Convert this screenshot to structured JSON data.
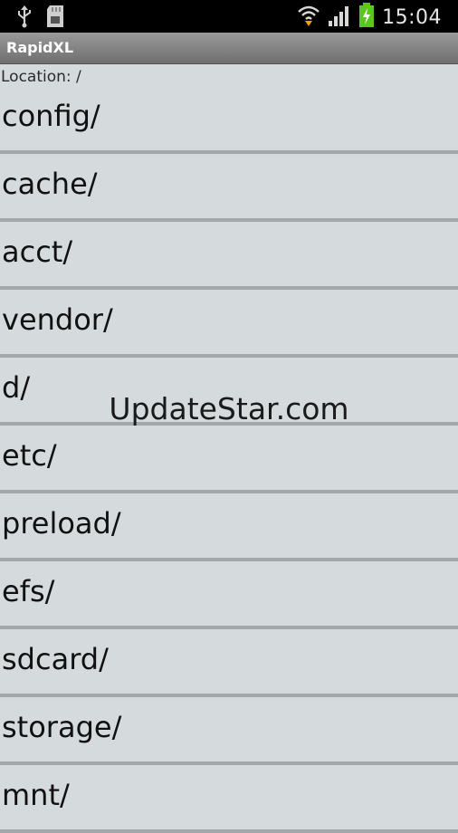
{
  "status_bar": {
    "time": "15:04",
    "icons": [
      "usb-icon",
      "sd-card-icon",
      "wifi-icon",
      "signal-icon",
      "battery-charging-icon"
    ],
    "accent": "#5cc61d"
  },
  "app": {
    "title": "RapidXL"
  },
  "location": {
    "label": "Location: /"
  },
  "directories": [
    "config/",
    "cache/",
    "acct/",
    "vendor/",
    "d/",
    "etc/",
    "preload/",
    "efs/",
    "sdcard/",
    "storage/",
    "mnt/"
  ],
  "watermark": "UpdateStar.com"
}
